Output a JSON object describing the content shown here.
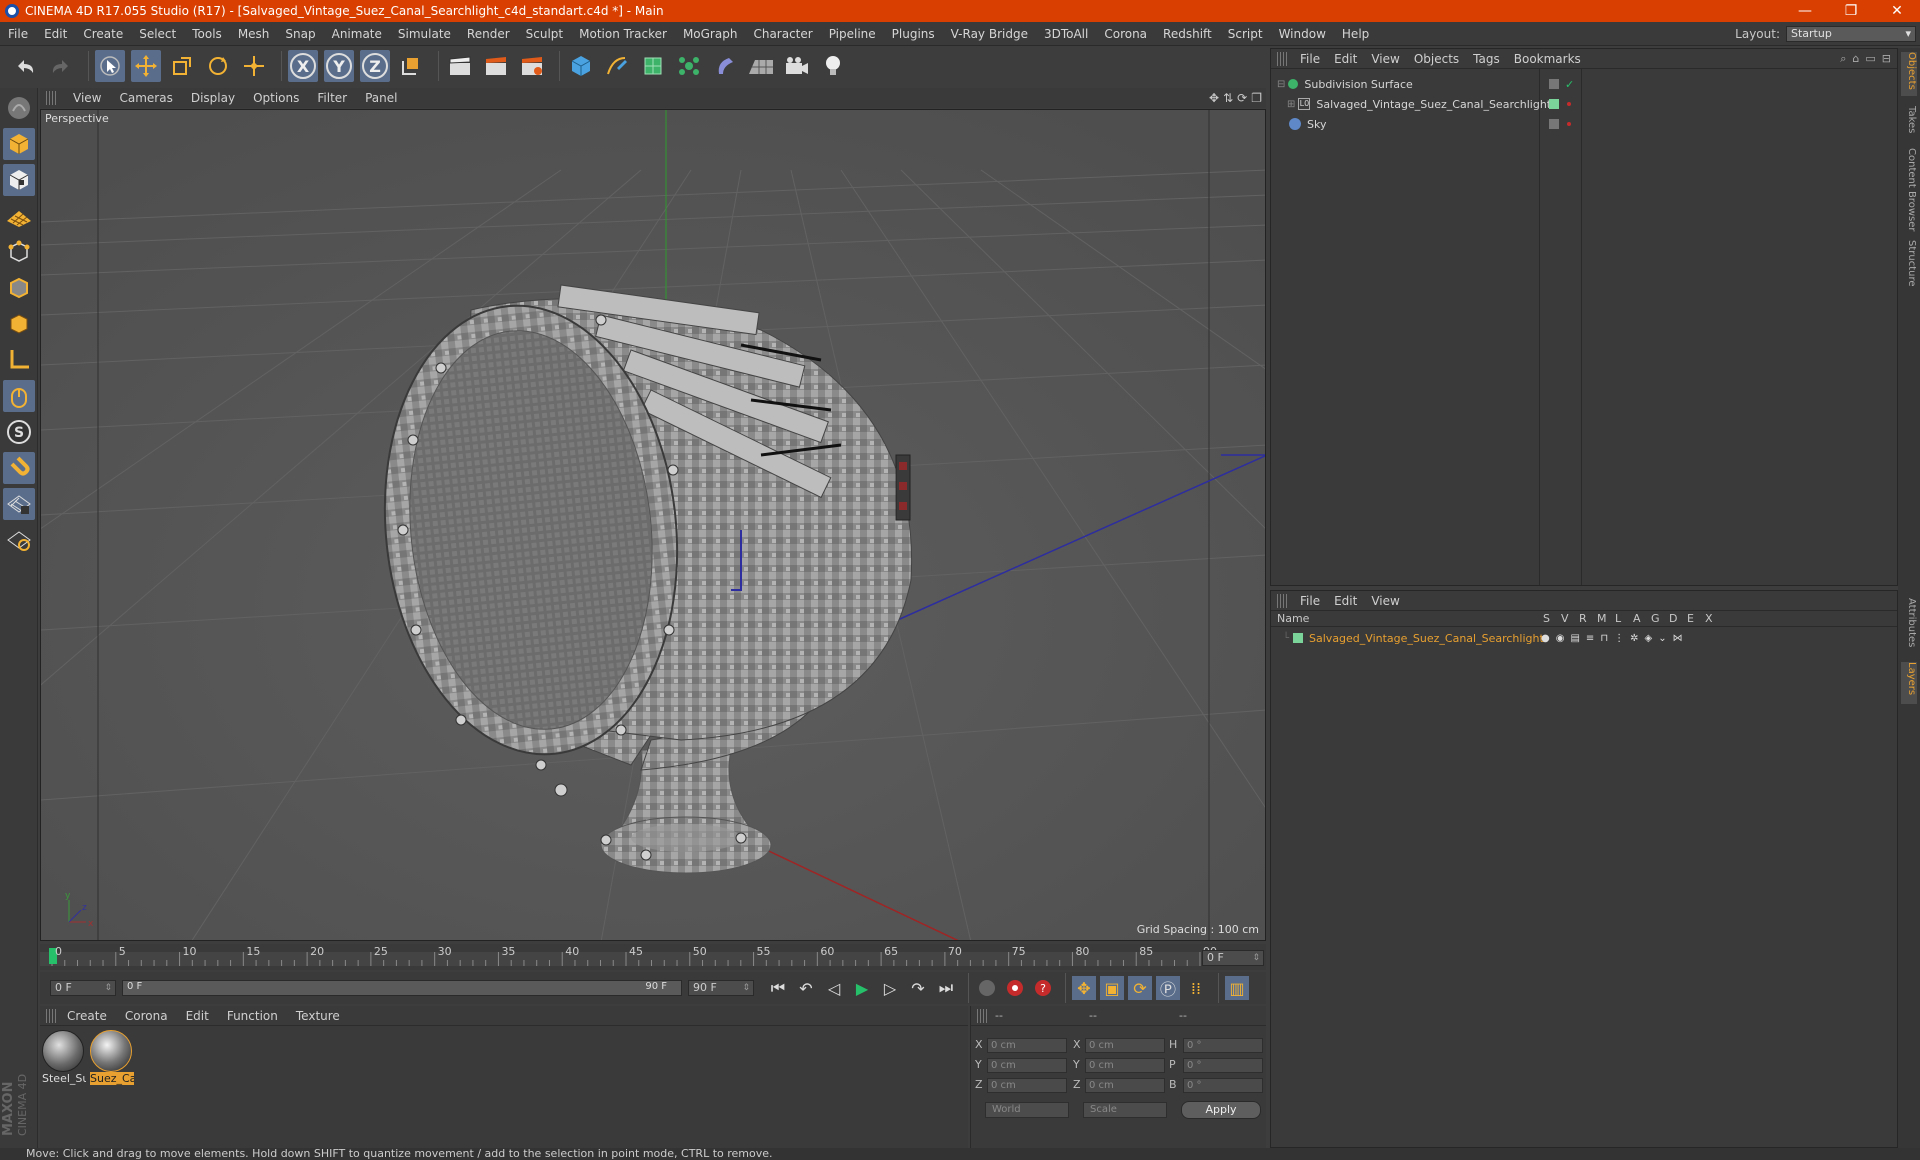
{
  "window": {
    "title": "CINEMA 4D R17.055 Studio (R17) - [Salvaged_Vintage_Suez_Canal_Searchlight_c4d_standart.c4d *] - Main",
    "minimize": "—",
    "restore": "❐",
    "close": "✕"
  },
  "menubar": {
    "items": [
      "File",
      "Edit",
      "Create",
      "Select",
      "Tools",
      "Mesh",
      "Snap",
      "Animate",
      "Simulate",
      "Render",
      "Sculpt",
      "Motion Tracker",
      "MoGraph",
      "Character",
      "Pipeline",
      "Plugins",
      "V-Ray Bridge",
      "3DToAll",
      "Corona",
      "Redshift",
      "Script",
      "Window",
      "Help"
    ],
    "layout_label": "Layout:",
    "layout_value": "Startup"
  },
  "viewport": {
    "menu": [
      "View",
      "Cameras",
      "Display",
      "Options",
      "Filter",
      "Panel"
    ],
    "label": "Perspective",
    "grid_spacing": "Grid Spacing : 100 cm"
  },
  "timeline": {
    "ticks": [
      "0",
      "5",
      "10",
      "15",
      "20",
      "25",
      "30",
      "35",
      "40",
      "45",
      "50",
      "55",
      "60",
      "65",
      "70",
      "75",
      "80",
      "85",
      "90"
    ],
    "end_field": "0 F"
  },
  "playbar": {
    "start": "0 F",
    "range_left": "0 F",
    "range_right": "90 F",
    "end": "90 F"
  },
  "materials": {
    "menu": [
      "Create",
      "Corona",
      "Edit",
      "Function",
      "Texture"
    ],
    "items": [
      {
        "label": "Steel_Su",
        "selected": false
      },
      {
        "label": "Suez_Ca",
        "selected": true
      }
    ]
  },
  "coords": {
    "headers": [
      "--",
      "--",
      "--"
    ],
    "rows": [
      {
        "a": "X",
        "v1": "0 cm",
        "b": "X",
        "v2": "0 cm",
        "c": "H",
        "v3": "0 °"
      },
      {
        "a": "Y",
        "v1": "0 cm",
        "b": "Y",
        "v2": "0 cm",
        "c": "P",
        "v3": "0 °"
      },
      {
        "a": "Z",
        "v1": "0 cm",
        "b": "Z",
        "v2": "0 cm",
        "c": "B",
        "v3": "0 °"
      }
    ],
    "space": "World",
    "mode": "Scale",
    "apply": "Apply"
  },
  "objects": {
    "menu": [
      "File",
      "Edit",
      "View",
      "Objects",
      "Tags",
      "Bookmarks"
    ],
    "items": [
      {
        "name": "Subdivision Surface",
        "icon": "subdivision-icon"
      },
      {
        "name": "Salvaged_Vintage_Suez_Canal_Searchlight",
        "icon": "null-object-icon"
      },
      {
        "name": "Sky",
        "icon": "sky-icon"
      }
    ]
  },
  "layers": {
    "menu": [
      "File",
      "Edit",
      "View"
    ],
    "header_name": "Name",
    "columns": [
      "S",
      "V",
      "R",
      "M",
      "L",
      "A",
      "G",
      "D",
      "E",
      "X"
    ],
    "item": "Salvaged_Vintage_Suez_Canal_Searchlight"
  },
  "sidetabs": {
    "top": [
      "Objects",
      "Takes",
      "Content Browser",
      "Structure"
    ],
    "bottom": [
      "Attributes",
      "Layers"
    ]
  },
  "brand": {
    "line1": "MAXON",
    "line2": "CINEMA 4D"
  },
  "status": "Move: Click and drag to move elements. Hold down SHIFT to quantize movement / add to the selection in point mode, CTRL to remove.",
  "colors": {
    "accent": "#d93f00",
    "selected": "#5a6e8c",
    "layer_name": "#e8a030"
  }
}
